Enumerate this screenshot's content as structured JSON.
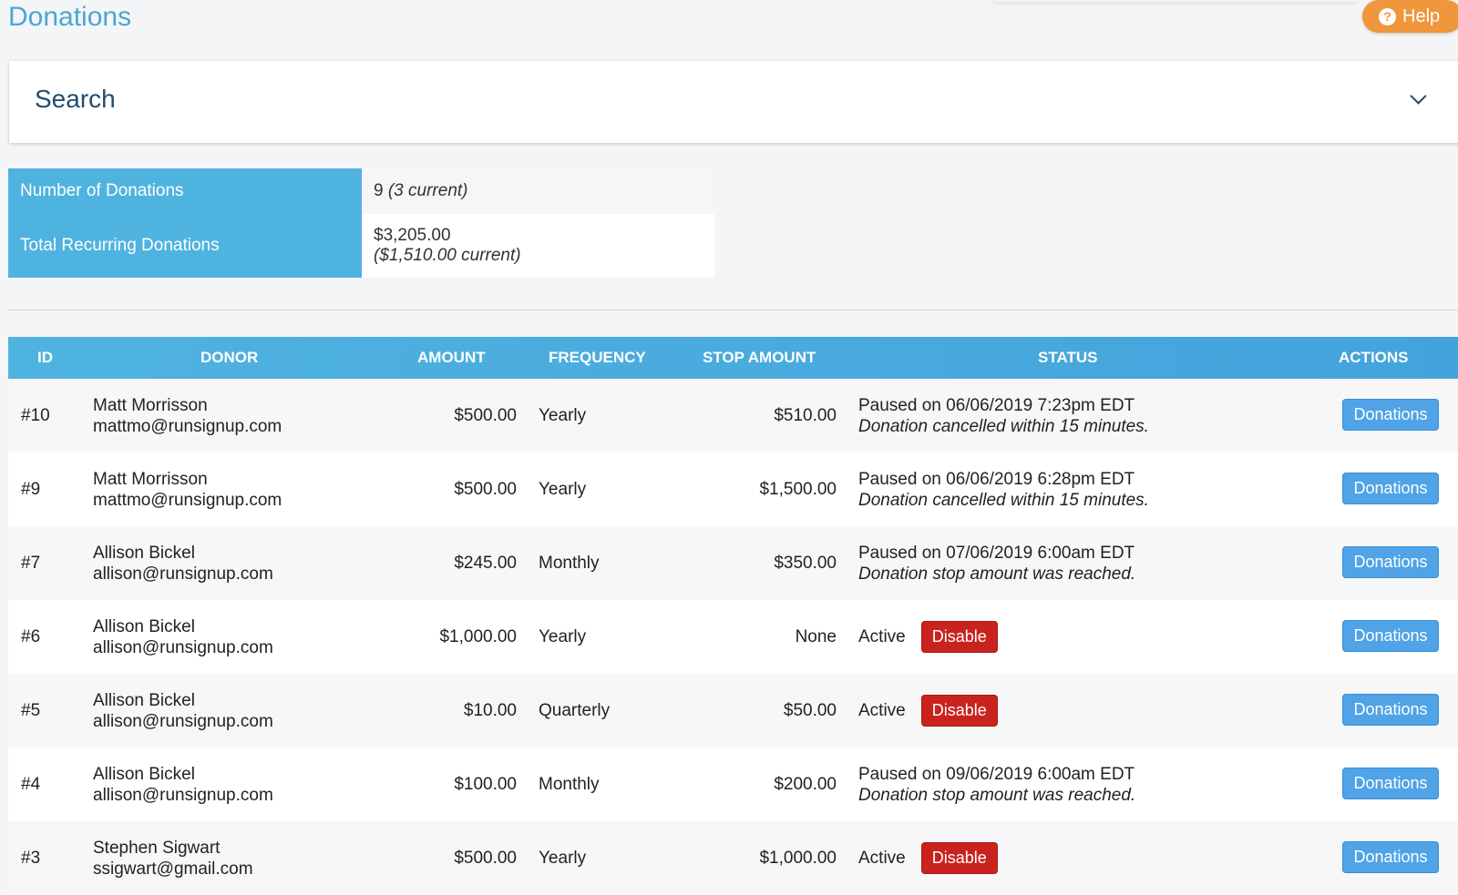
{
  "page": {
    "title": "Donations",
    "help_label": "Help"
  },
  "search": {
    "title": "Search"
  },
  "summary": {
    "num_label": "Number of Donations",
    "num_value": "9",
    "num_current": "(3 current)",
    "total_label": "Total Recurring Donations",
    "total_value": "$3,205.00",
    "total_current": "($1,510.00 current)"
  },
  "table": {
    "headers": {
      "id": "ID",
      "donor": "DONOR",
      "amount": "AMOUNT",
      "frequency": "FREQUENCY",
      "stop_amount": "STOP AMOUNT",
      "status": "STATUS",
      "actions": "ACTIONS"
    },
    "rows": [
      {
        "id": "#10",
        "name": "Matt Morrisson",
        "email": "mattmo@runsignup.com",
        "amount": "$500.00",
        "frequency": "Yearly",
        "stop": "$510.00",
        "status_line": "Paused on 06/06/2019 7:23pm EDT",
        "status_note": "Donation cancelled within 15 minutes.",
        "action": "Donations"
      },
      {
        "id": "#9",
        "name": "Matt Morrisson",
        "email": "mattmo@runsignup.com",
        "amount": "$500.00",
        "frequency": "Yearly",
        "stop": "$1,500.00",
        "status_line": "Paused on 06/06/2019 6:28pm EDT",
        "status_note": "Donation cancelled within 15 minutes.",
        "action": "Donations"
      },
      {
        "id": "#7",
        "name": "Allison Bickel",
        "email": "allison@runsignup.com",
        "amount": "$245.00",
        "frequency": "Monthly",
        "stop": "$350.00",
        "status_line": "Paused on 07/06/2019 6:00am EDT",
        "status_note": "Donation stop amount was reached.",
        "action": "Donations"
      },
      {
        "id": "#6",
        "name": "Allison Bickel",
        "email": "allison@runsignup.com",
        "amount": "$1,000.00",
        "frequency": "Yearly",
        "stop": "None",
        "status": "Active",
        "disable": "Disable",
        "action": "Donations"
      },
      {
        "id": "#5",
        "name": "Allison Bickel",
        "email": "allison@runsignup.com",
        "amount": "$10.00",
        "frequency": "Quarterly",
        "stop": "$50.00",
        "status": "Active",
        "disable": "Disable",
        "action": "Donations"
      },
      {
        "id": "#4",
        "name": "Allison Bickel",
        "email": "allison@runsignup.com",
        "amount": "$100.00",
        "frequency": "Monthly",
        "stop": "$200.00",
        "status_line": "Paused on 09/06/2019 6:00am EDT",
        "status_note": "Donation stop amount was reached.",
        "action": "Donations"
      },
      {
        "id": "#3",
        "name": "Stephen Sigwart",
        "email": "ssigwart@gmail.com",
        "amount": "$500.00",
        "frequency": "Yearly",
        "stop": "$1,000.00",
        "status": "Active",
        "disable": "Disable",
        "action": "Donations"
      }
    ]
  }
}
